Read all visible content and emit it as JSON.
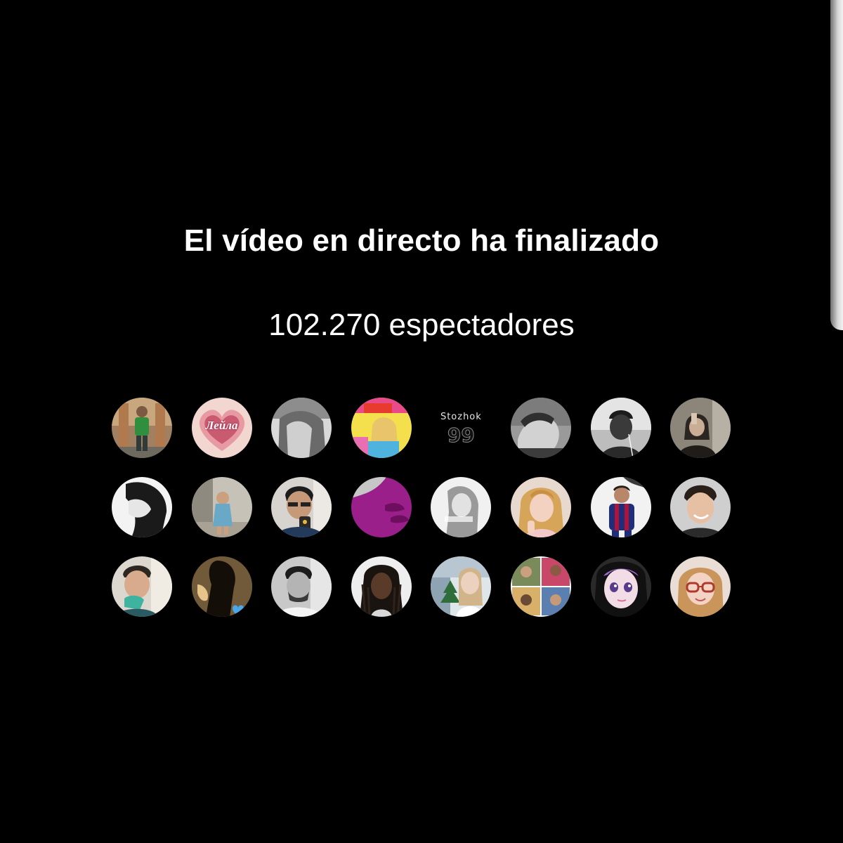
{
  "live_end": {
    "title": "El vídeo en directo ha finalizado",
    "viewers": "102.270 espectadores"
  },
  "viewer_avatars": {
    "rows": 3,
    "columns": 8,
    "items": [
      {
        "icon": "avatar-man-green-shirt"
      },
      {
        "icon": "avatar-heart-hands",
        "text": "Лейла"
      },
      {
        "icon": "avatar-grayscale-woman"
      },
      {
        "icon": "avatar-colorful-collage"
      },
      {
        "icon": "avatar-text-logo",
        "text_top": "Stozhok",
        "text_big": "99"
      },
      {
        "icon": "avatar-grayscale-man"
      },
      {
        "icon": "avatar-man-beanie"
      },
      {
        "icon": "avatar-mirror-selfie"
      },
      {
        "icon": "avatar-bw-woman-profile"
      },
      {
        "icon": "avatar-child-photo"
      },
      {
        "icon": "avatar-man-phone-selfie"
      },
      {
        "icon": "avatar-purple-abstract"
      },
      {
        "icon": "avatar-bw-woman-light"
      },
      {
        "icon": "avatar-woman-blonde"
      },
      {
        "icon": "avatar-football-player"
      },
      {
        "icon": "avatar-young-man-smile"
      },
      {
        "icon": "avatar-man-hand-chin"
      },
      {
        "icon": "avatar-silhouette-heart"
      },
      {
        "icon": "avatar-bw-man-car"
      },
      {
        "icon": "avatar-woman-braids"
      },
      {
        "icon": "avatar-woman-christmas-tree"
      },
      {
        "icon": "avatar-photo-collage"
      },
      {
        "icon": "avatar-anime-eyes-woman"
      },
      {
        "icon": "avatar-girl-glasses"
      }
    ]
  }
}
